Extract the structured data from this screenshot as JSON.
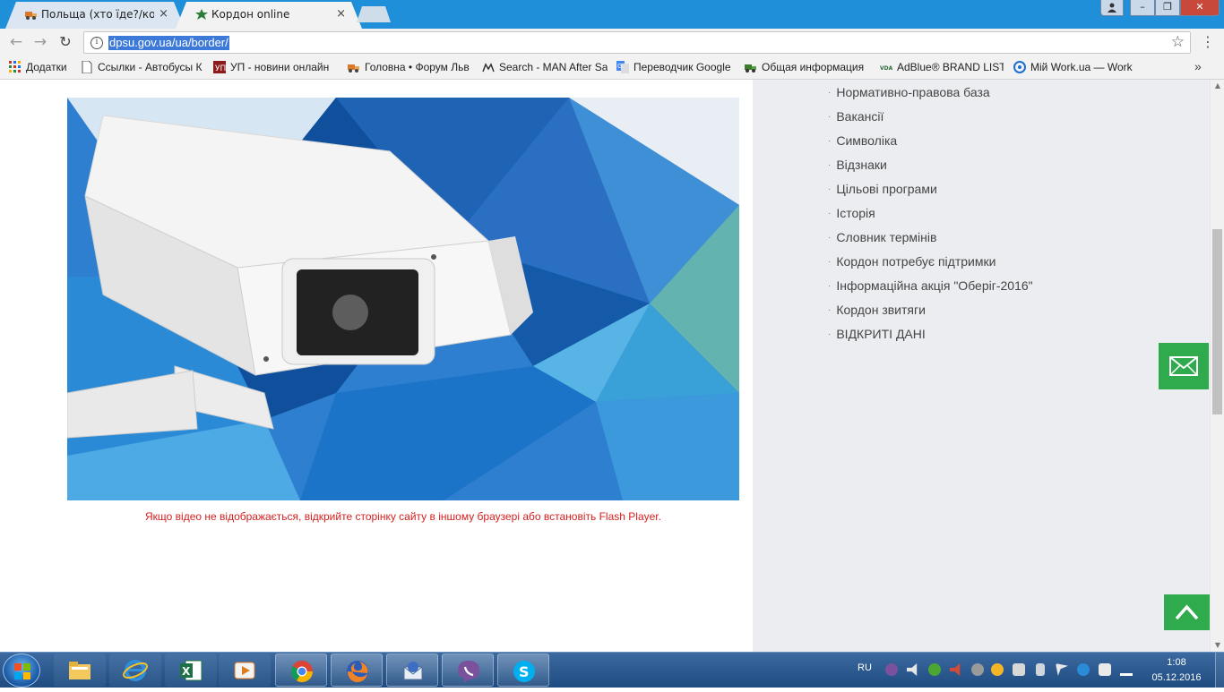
{
  "browser": {
    "tabs": [
      {
        "title": "Польща (хто їде?/кого п",
        "active": false,
        "close": "×"
      },
      {
        "title": "Кордон online",
        "active": true,
        "close": "×"
      }
    ],
    "window_buttons": {
      "minimize": "–",
      "maximize": "❐",
      "close": "✕"
    },
    "nav": {
      "back": "←",
      "forward": "→",
      "reload": "↻"
    },
    "url": "dpsu.gov.ua/ua/border/",
    "info_glyph": "i",
    "star_glyph": "☆",
    "menu_glyph": "⋮",
    "bookmarks": [
      {
        "label": "Додатки",
        "icon": "apps-grid-icon"
      },
      {
        "label": "Ссылки - Автобусы К",
        "icon": "page-icon"
      },
      {
        "label": "УП - новини онлайн",
        "icon": "up-logo-icon"
      },
      {
        "label": "Головна • Форум Льв",
        "icon": "truck-icon"
      },
      {
        "label": "Search - MAN After Sa",
        "icon": "man-logo-icon"
      },
      {
        "label": "Переводчик Google",
        "icon": "google-translate-icon"
      },
      {
        "label": "Общая информация",
        "icon": "truck-green-icon"
      },
      {
        "label": "AdBlue® BRAND LIST",
        "icon": "vda-logo-icon"
      },
      {
        "label": "Мій Work.ua — Work",
        "icon": "workua-logo-icon"
      }
    ],
    "bookmarks_overflow": "»"
  },
  "page": {
    "flash_notice": "Якщо відео не відображається, відкрийте сторінку сайту в іншому браузері або встановіть Flash Player.",
    "sidebar_menu": [
      "Нормативно-правова база",
      "Вакансії",
      "Символіка",
      "Відзнаки",
      "Цільові програми",
      "Історія",
      "Словник термінів",
      "Кордон потребує підтримки",
      "Інформаційна акція \"Оберіг-2016\"",
      "Кордон звитяги",
      "ВІДКРИТІ ДАНІ"
    ],
    "bullet": "·",
    "scroll_up": "▲",
    "scroll_down": "▼",
    "accent_color": "#2faa4c",
    "notice_color": "#d4201f"
  },
  "taskbar": {
    "apps": [
      {
        "name": "windows-explorer",
        "state": "pinned"
      },
      {
        "name": "internet-explorer",
        "state": "pinned"
      },
      {
        "name": "excel",
        "state": "pinned"
      },
      {
        "name": "media-player",
        "state": "pinned"
      },
      {
        "name": "chrome",
        "state": "running"
      },
      {
        "name": "firefox",
        "state": "running"
      },
      {
        "name": "thunderbird",
        "state": "running"
      },
      {
        "name": "viber",
        "state": "running"
      },
      {
        "name": "skype",
        "state": "running"
      }
    ],
    "language": "RU",
    "time": "1:08",
    "date": "05.12.2016"
  }
}
